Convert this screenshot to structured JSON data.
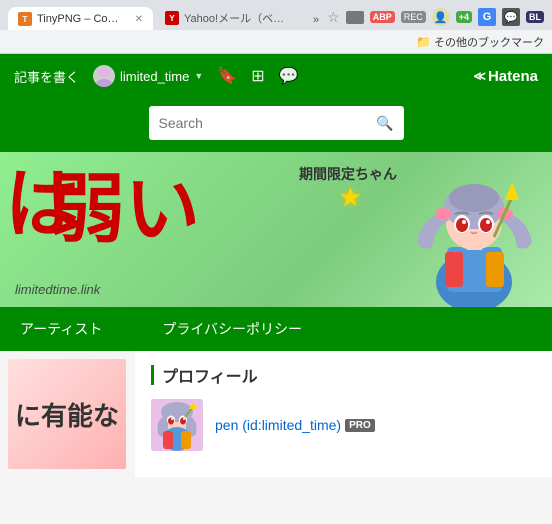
{
  "browser": {
    "tabs": [
      {
        "id": "tinypng",
        "label": "TinyPNG – Compress...",
        "favicon_color": "#e87722",
        "favicon_text": "T",
        "active": false
      },
      {
        "id": "yahoo",
        "label": "Yahoo!メール（ベータ版",
        "favicon_color": "#c00",
        "favicon_text": "Y",
        "active": false
      }
    ],
    "tab_more_label": "»",
    "bookmark_items": [
      {
        "id": "other-bookmarks",
        "label": "その他のブックマーク"
      }
    ],
    "icons": {
      "star": "☆",
      "mail": "✉",
      "adb": "ABP",
      "rec": "REC",
      "user": "👤",
      "plus4": "4",
      "g": "G",
      "chat": "💬",
      "bi": "BL"
    }
  },
  "hatena_header": {
    "write_label": "記事を書く",
    "user_name": "limited_time",
    "bookmark_mark": "🔖",
    "grid_icon": "⊞",
    "comment_icon": "💬",
    "logo": "Hatena"
  },
  "search": {
    "placeholder": "Search",
    "icon": "🔍"
  },
  "hero": {
    "title_ja": "弱い",
    "prefix_ja": "は",
    "subtitle": "期間限定ちゃん",
    "url": "limitedtime.link",
    "star": "★"
  },
  "nav": {
    "items": [
      {
        "id": "artist",
        "label": "アーティスト"
      },
      {
        "id": "privacy",
        "label": "プライバシーポリシー"
      }
    ]
  },
  "profile": {
    "section_title": "プロフィール",
    "user_name": "pen (id:limited_time)",
    "pro_badge": "PRO",
    "sidebar_text": "に有能な"
  }
}
